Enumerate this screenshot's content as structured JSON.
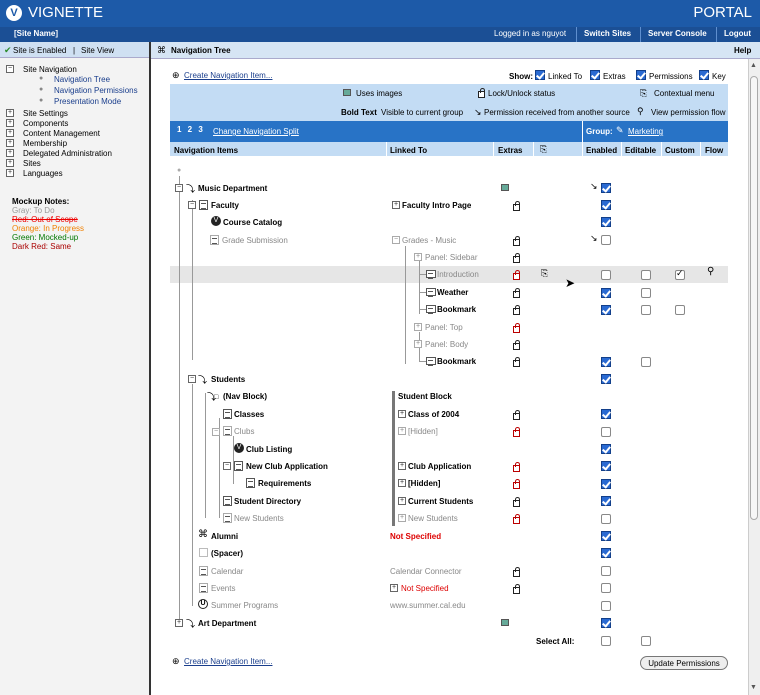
{
  "header": {
    "brand": "VIGNETTE",
    "portal": "PORTAL",
    "logo": "V",
    "site": "[Site Name]",
    "logged": "Logged in as nguyot",
    "switch": "Switch Sites",
    "console": "Server Console",
    "logout": "Logout",
    "help": "Help"
  },
  "status": {
    "enabled": "Site is Enabled",
    "sep": " | ",
    "view": "Site View"
  },
  "sidebar": {
    "siteNav": "Site Navigation",
    "sub": [
      "Navigation Tree",
      "Navigation Permissions",
      "Presentation Mode"
    ],
    "items": [
      "Site Settings",
      "Components",
      "Content Management",
      "Membership",
      "Delegated Administration",
      "Sites",
      "Languages"
    ],
    "notesTitle": "Mockup Notes:",
    "notes": [
      "Gray: To Do",
      "Red: Out of Scope",
      "Orange: In Progress",
      "Green: Mocked-up",
      "Dark Red: Same"
    ]
  },
  "main": {
    "title": "Navigation Tree",
    "create": "Create Navigation Item...",
    "show": "Show:",
    "showOpts": [
      "Linked To",
      "Extras",
      "Permissions",
      "Key"
    ],
    "key": {
      "usesImages": "Uses images",
      "lockUnlock": "Lock/Unlock status",
      "ctxMenu": "Contextual menu",
      "boldText": "Bold Text",
      "boldDesc": "Visible to current group",
      "permRecv": "Permission received from another source",
      "permFlow": "View permission flow"
    },
    "split": "Change Navigation Split",
    "splitNums": "1 2 3",
    "group": "Group:",
    "groupVal": "Marketing",
    "cols": [
      "Navigation Items",
      "Linked To",
      "Extras",
      "Enabled",
      "Editable",
      "Custom",
      "Flow"
    ],
    "selectAll": "Select All:",
    "update": "Update Permissions"
  },
  "rows": [
    {
      "l": "Music Department",
      "t": "b"
    },
    {
      "l": "Faculty",
      "t": "b",
      "lk": "Faculty Intro Page",
      "lt": "b"
    },
    {
      "l": "Course Catalog",
      "t": "b"
    },
    {
      "l": "Grade Submission",
      "t": "g",
      "lk": "Grades - Music",
      "lt": "g"
    },
    {
      "l": "",
      "lk": "Panel: Sidebar",
      "lt": "g"
    },
    {
      "l": "",
      "lk": "Introduction",
      "lt": "g"
    },
    {
      "l": "",
      "lk": "Weather",
      "lt": "b"
    },
    {
      "l": "",
      "lk": "Bookmark",
      "lt": "b"
    },
    {
      "l": "",
      "lk": "Panel: Top",
      "lt": "g"
    },
    {
      "l": "",
      "lk": "Panel: Body",
      "lt": "g"
    },
    {
      "l": "",
      "lk": "Bookmark",
      "lt": "b"
    },
    {
      "l": "Students",
      "t": "b"
    },
    {
      "l": "(Nav Block)",
      "t": "b",
      "lk": "Student Block",
      "lt": "b"
    },
    {
      "l": "Classes",
      "t": "b",
      "lk": "Class of 2004",
      "lt": "b"
    },
    {
      "l": "Clubs",
      "t": "g",
      "lk": "[Hidden]",
      "lt": "g"
    },
    {
      "l": "Club Listing",
      "t": "b"
    },
    {
      "l": "New Club Application",
      "t": "b",
      "lk": "Club Application",
      "lt": "b"
    },
    {
      "l": "Requirements",
      "t": "b",
      "lk": "[Hidden]",
      "lt": "b"
    },
    {
      "l": "Student Directory",
      "t": "b",
      "lk": "Current Students",
      "lt": "b"
    },
    {
      "l": "New Students",
      "t": "g",
      "lk": "New Students",
      "lt": "g"
    },
    {
      "l": "Alumni",
      "t": "b",
      "lk": "Not Specified",
      "lt": "r"
    },
    {
      "l": "(Spacer)",
      "t": "b"
    },
    {
      "l": "Calendar",
      "t": "g",
      "lk": "Calendar Connector",
      "lt": "g"
    },
    {
      "l": "Events",
      "t": "g",
      "lk": "Not Specified",
      "lt": "r"
    },
    {
      "l": "Summer Programs",
      "t": "g",
      "lk": "www.summer.cal.edu",
      "lt": "g"
    },
    {
      "l": "Art Department",
      "t": "b"
    }
  ]
}
